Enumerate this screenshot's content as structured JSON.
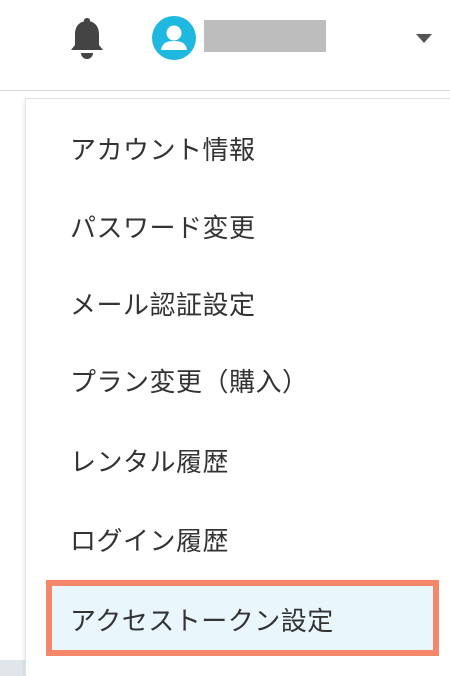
{
  "header": {
    "notification_icon": "bell-icon",
    "avatar_icon": "user-avatar-icon",
    "username": "",
    "dropdown_icon": "caret-down-icon",
    "colors": {
      "bell": "#444444",
      "avatar": "#1fb8e0",
      "username_redaction": "#bdbdbd"
    }
  },
  "menu": {
    "items": [
      {
        "label": "アカウント情報"
      },
      {
        "label": "パスワード変更"
      },
      {
        "label": "メール認証設定"
      },
      {
        "label": "プラン変更（購入）"
      },
      {
        "label": "レンタル履歴"
      },
      {
        "label": "ログイン履歴"
      },
      {
        "label": "アクセストークン設定",
        "highlighted": true
      }
    ],
    "colors": {
      "highlight_border": "#f6866a",
      "highlight_background": "#e9f6fc",
      "text": "#333333"
    }
  }
}
